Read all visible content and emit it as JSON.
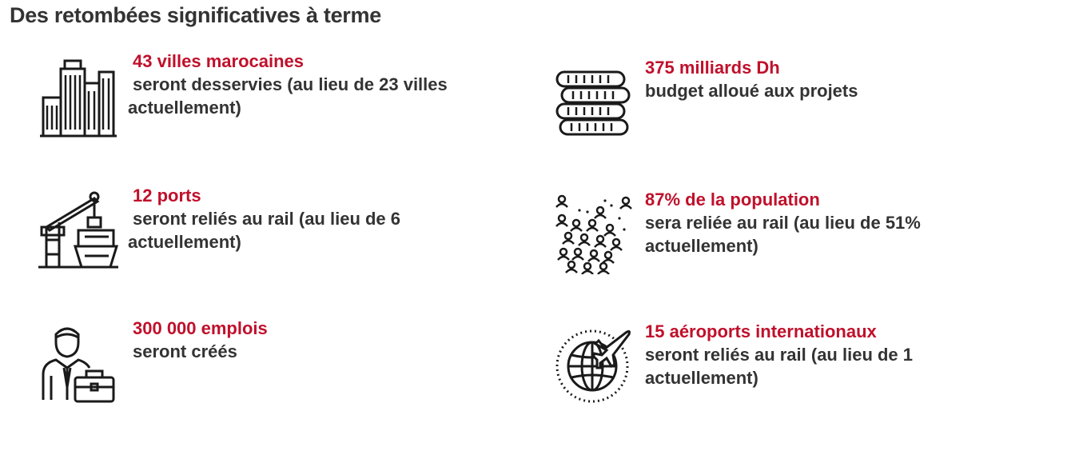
{
  "page": {
    "title": "Des retombées significatives à terme"
  },
  "colors": {
    "accent": "#c0102b",
    "text": "#333333",
    "icon": "#1a1a1a"
  },
  "items": [
    {
      "icon": "city-buildings-icon",
      "headline": "43 villes marocaines",
      "desc": "seront desservies (au lieu de 23 villes actuellement)"
    },
    {
      "icon": "coin-stack-icon",
      "headline": "375 milliards Dh",
      "desc": "budget alloué aux projets"
    },
    {
      "icon": "port-crane-ship-icon",
      "headline": "12 ports",
      "desc": "seront reliés au rail (au lieu de 6 actuellement)"
    },
    {
      "icon": "population-crowd-icon",
      "headline": "87% de la population",
      "desc": "sera reliée au rail (au lieu de 51% actuellement)"
    },
    {
      "icon": "worker-briefcase-icon",
      "headline": "300 000 emplois",
      "desc": "seront créés"
    },
    {
      "icon": "globe-airplane-icon",
      "headline": "15 aéroports internationaux",
      "desc": "seront reliés au rail (au lieu de 1 actuellement)"
    }
  ]
}
